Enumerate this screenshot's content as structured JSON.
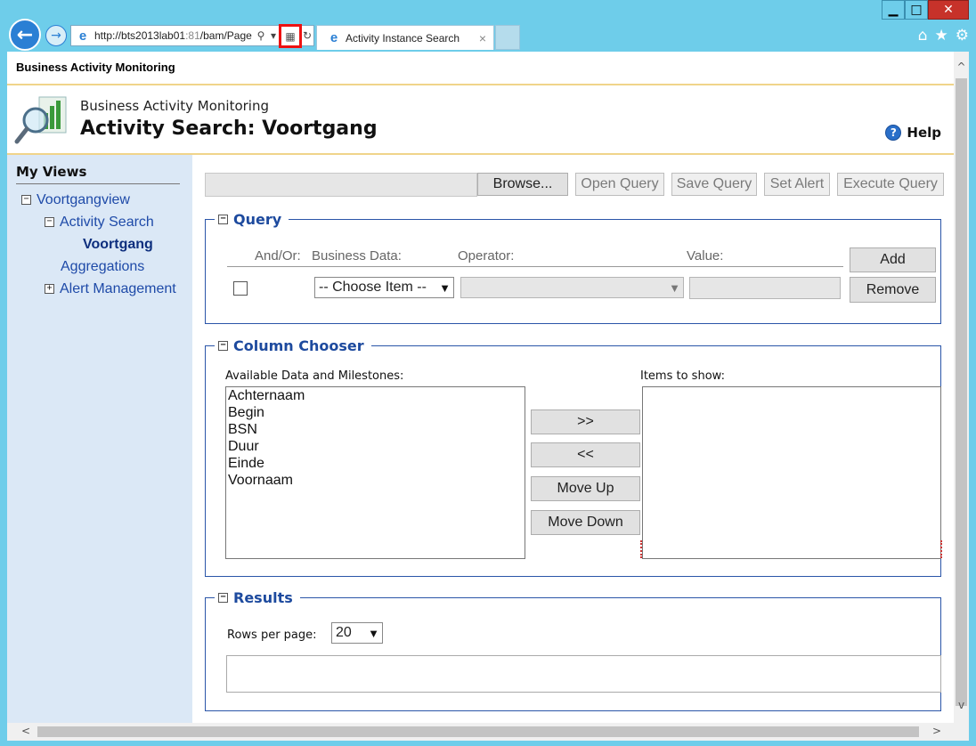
{
  "browser": {
    "url_host": "http://bts2013lab01",
    "url_port": ":81",
    "url_path": "/bam/Page",
    "tab_title": "Activity Instance Search",
    "tab_close": "×"
  },
  "page": {
    "topbar_title": "Business Activity Monitoring",
    "header_subtitle": "Business Activity Monitoring",
    "header_title": "Activity Search: Voortgang",
    "help_label": "Help"
  },
  "sidebar": {
    "title": "My Views",
    "items": [
      {
        "label": "Voortgangview",
        "toggle": "−"
      },
      {
        "label": "Activity Search",
        "toggle": "−"
      },
      {
        "label": "Voortgang"
      },
      {
        "label": "Aggregations"
      },
      {
        "label": "Alert Management",
        "toggle": "+"
      }
    ]
  },
  "toolbar": {
    "browse": "Browse...",
    "open_query": "Open Query",
    "save_query": "Save Query",
    "set_alert": "Set Alert",
    "execute_query": "Execute Query"
  },
  "query": {
    "legend": "Query",
    "toggle": "−",
    "col_andor": "And/Or:",
    "col_business_data": "Business Data:",
    "col_operator": "Operator:",
    "col_value": "Value:",
    "business_data_selected": "-- Choose Item --",
    "operator_selected": "",
    "value": "",
    "add": "Add",
    "remove": "Remove"
  },
  "column_chooser": {
    "legend": "Column Chooser",
    "toggle": "−",
    "available_label": "Available Data and Milestones:",
    "available_items": [
      "Achternaam",
      "Begin",
      "BSN",
      "Duur",
      "Einde",
      "Voornaam"
    ],
    "show_label": "Items to show:",
    "add_btn": ">>",
    "remove_btn": "<<",
    "move_up": "Move Up",
    "move_down": "Move Down"
  },
  "results": {
    "legend": "Results",
    "toggle": "−",
    "rows_per_page_label": "Rows per page:",
    "rows_per_page": "20"
  },
  "icons": {
    "compat_view": "compat-view-icon",
    "home": "home-icon",
    "favorites": "star-icon",
    "tools": "gear-icon"
  },
  "colors": {
    "chrome": "#6ecdea",
    "sidebar": "#dbe8f6",
    "accent": "#1d4a9e",
    "rule": "#f0d48a",
    "highlight": "#e11111"
  }
}
